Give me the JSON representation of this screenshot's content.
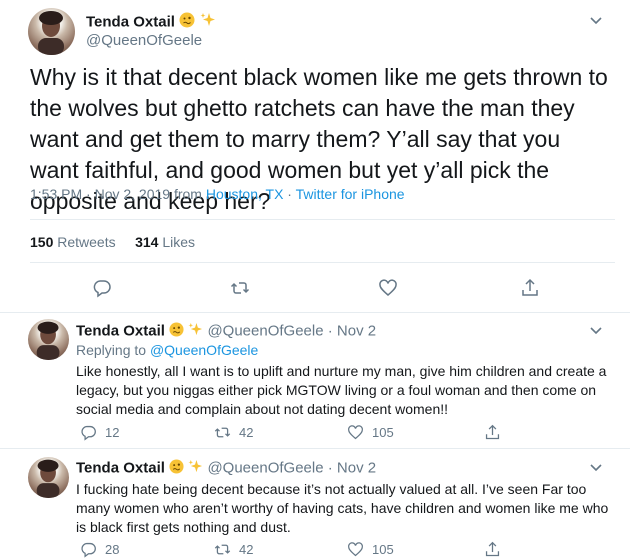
{
  "main": {
    "display_name": "Tenda Oxtail",
    "handle": "@QueenOfGeele",
    "text": "Why is it that decent black women like me gets thrown to the wolves but ghetto ratchets can have the man they want and get them to marry them? Y’all say that you want faithful, and good women but yet y’all pick the opposite and keep her?",
    "time": "1:53 PM · Nov 2, 2019 from ",
    "location": "Houston, TX",
    "separator": " · ",
    "source": "Twitter for iPhone",
    "retweets_count": "150",
    "retweets_label": "Retweets",
    "likes_count": "314",
    "likes_label": "Likes"
  },
  "replies": [
    {
      "display_name": "Tenda Oxtail",
      "handle": "@QueenOfGeele · Nov 2",
      "replying_prefix": "Replying to ",
      "replying_handle": "@QueenOfGeele",
      "text": "Like honestly, all I want is to uplift and nurture my man, give him children and create a legacy, but you niggas either pick MGTOW living or a foul woman and then come on social media and complain about not dating decent women!!",
      "reply_count": "12",
      "retweet_count": "42",
      "like_count": "105"
    },
    {
      "display_name": "Tenda Oxtail",
      "handle": "@QueenOfGeele · Nov 2",
      "text": "I fucking hate being decent because it’s not actually valued at all. I’ve seen Far too many women who aren’t worthy of having cats, have children and women like me who is black first gets nothing and dust.",
      "reply_count": "28",
      "retweet_count": "42",
      "like_count": "105"
    }
  ],
  "icons": {
    "emoji_1": "woozy-face-emoji",
    "emoji_2": "sparkles-emoji",
    "menu": "chevron-down-icon",
    "reply": "reply-icon",
    "retweet": "retweet-icon",
    "like": "heart-icon",
    "share": "share-icon"
  },
  "colors": {
    "text": "#14171a",
    "secondary": "#657786",
    "link": "#1b95e0",
    "divider": "#e6ecf0",
    "emoji_yellow": "#f7c235"
  }
}
